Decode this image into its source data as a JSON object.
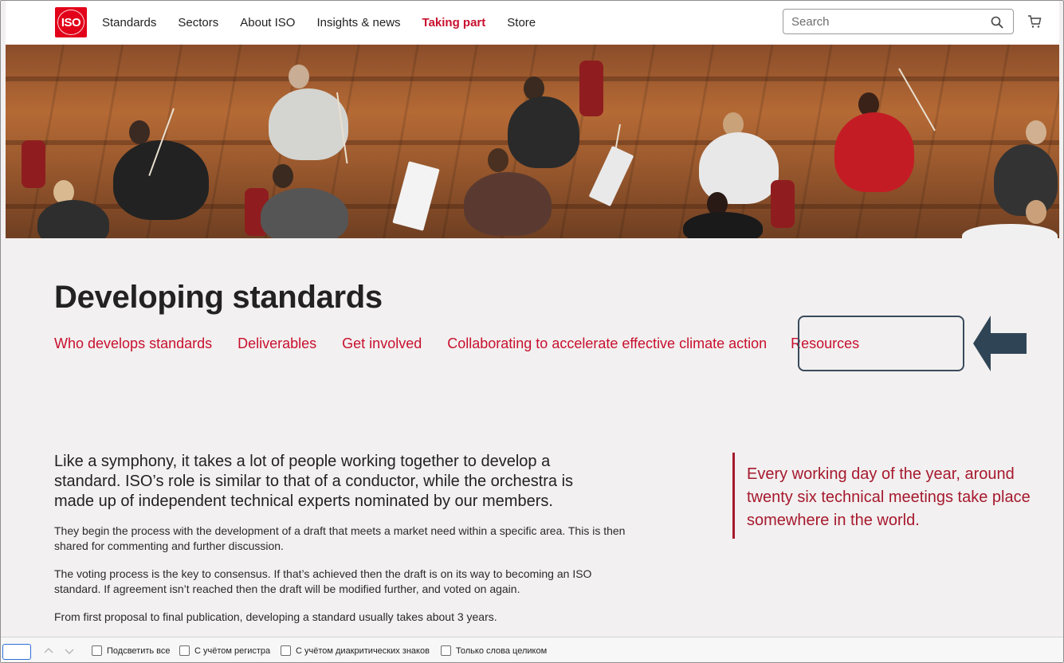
{
  "header": {
    "logo_text": "ISO",
    "nav": [
      {
        "label": "Standards",
        "active": false
      },
      {
        "label": "Sectors",
        "active": false
      },
      {
        "label": "About ISO",
        "active": false
      },
      {
        "label": "Insights & news",
        "active": false
      },
      {
        "label": "Taking part",
        "active": true
      },
      {
        "label": "Store",
        "active": false
      }
    ],
    "search_placeholder": "Search"
  },
  "page": {
    "title": "Developing standards",
    "subnav": [
      "Who develops standards",
      "Deliverables",
      "Get involved",
      "Collaborating to accelerate effective climate action",
      "Resources"
    ],
    "lead": "Like a symphony, it takes a lot of people working together to develop a standard. ISO’s role is similar to that of a conductor, while the orchestra is made up of independent technical experts nominated by our members.",
    "paragraphs": [
      "They begin the process with the development of a draft that meets a market need within a specific area. This is then shared for commenting and further discussion.",
      "The voting process is the key to consensus. If that’s achieved then the draft is on its way to becoming an ISO standard. If agreement isn’t reached then the draft will be modified further, and voted on again.",
      "From first proposal to final publication, developing a standard usually takes about 3 years."
    ],
    "quote": "Every working day of the year, around twenty six technical meetings take place somewhere in the world."
  },
  "findbar": {
    "options": [
      "Подсветить все",
      "С учётом регистра",
      "С учётом диакритических знаков",
      "Только слова целиком"
    ]
  },
  "colors": {
    "brand_red": "#c8102e",
    "quote_red": "#a6192e",
    "highlight_border": "#3a4a5c",
    "arrow": "#2f4556"
  },
  "icons": [
    "iso-logo",
    "search-icon",
    "cart-icon",
    "arrow-left-icon",
    "chevron-up-icon",
    "chevron-down-icon"
  ]
}
